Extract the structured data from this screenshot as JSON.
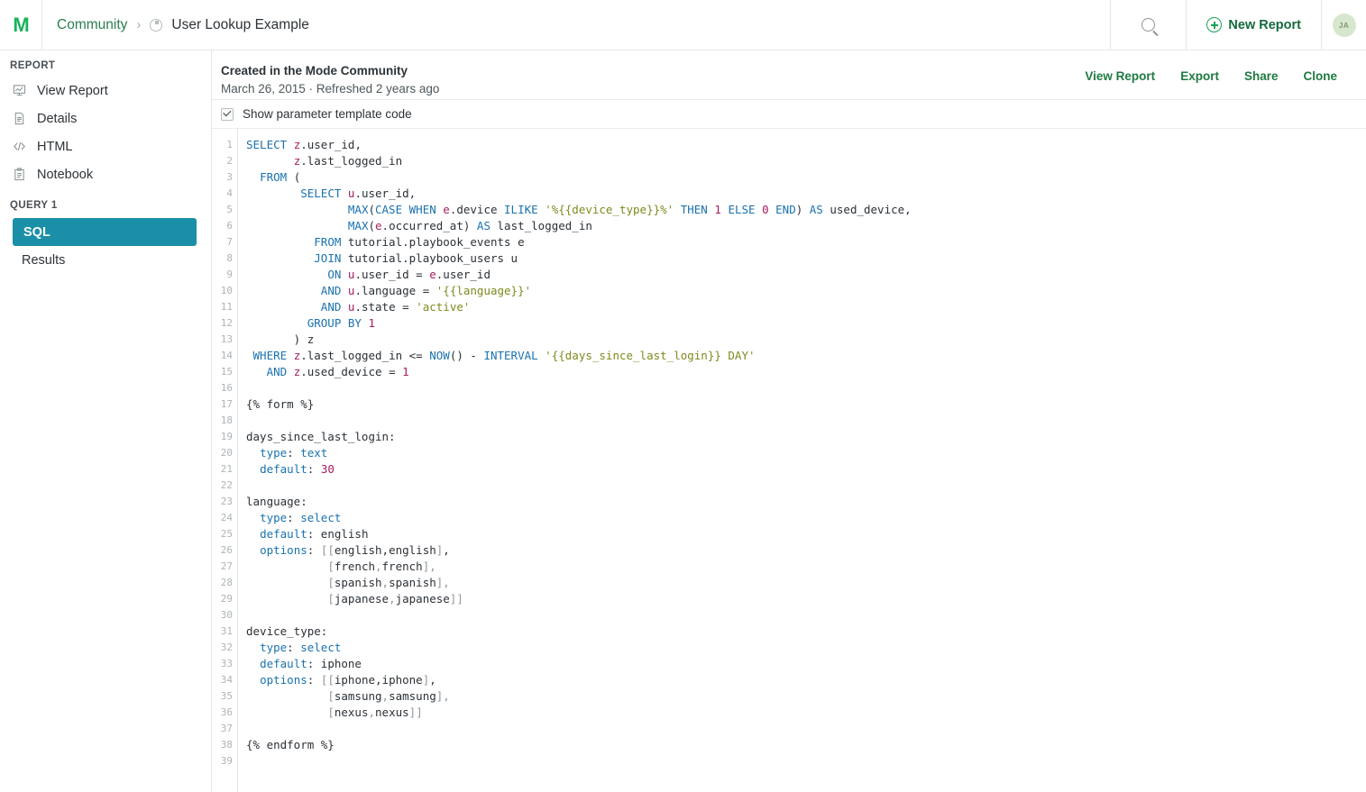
{
  "header": {
    "logo_icon": "mode-logo-icon",
    "breadcrumb": {
      "parent_label": "Community",
      "separator": "›",
      "current_icon": "clock-icon",
      "current_label": "User Lookup Example"
    },
    "search_icon": "search-icon",
    "new_report_label": "New Report",
    "new_report_icon": "plus-circle-icon",
    "avatar_initials": "JA"
  },
  "sidebar": {
    "report_section_title": "REPORT",
    "report_items": [
      {
        "label": "View Report",
        "icon": "chart-report-icon"
      },
      {
        "label": "Details",
        "icon": "document-icon"
      },
      {
        "label": "HTML",
        "icon": "code-brackets-icon"
      },
      {
        "label": "Notebook",
        "icon": "notebook-icon"
      }
    ],
    "query_section_title": "QUERY 1",
    "query_items": [
      {
        "label": "SQL",
        "selected": true
      },
      {
        "label": "Results",
        "selected": false
      }
    ],
    "selected_color": "#1b8fa8"
  },
  "sub_header": {
    "title": "Created in the Mode Community",
    "meta": "March 26, 2015 · Refreshed 2 years ago",
    "actions": [
      "View Report",
      "Export",
      "Share",
      "Clone"
    ],
    "action_color": "#1f7a42"
  },
  "parameter_bar": {
    "checkbox_checked": true,
    "checkbox_label": "Show parameter template code"
  },
  "editor": {
    "first_line_number": 1,
    "last_line_number": 39,
    "line_numbers": [
      1,
      2,
      3,
      4,
      5,
      6,
      7,
      8,
      9,
      10,
      11,
      12,
      13,
      14,
      15,
      16,
      17,
      18,
      19,
      20,
      21,
      22,
      23,
      24,
      25,
      26,
      27,
      28,
      29,
      30,
      31,
      32,
      33,
      34,
      35,
      36,
      37,
      38,
      39
    ],
    "language": "sql",
    "syntax_colors": {
      "keyword": "#1a72b0",
      "string": "#7f8a1e",
      "number": "#a71d5d",
      "alias": "#a71d5d",
      "plain": "#2b3137",
      "gutter": "#aeb4b8"
    },
    "lines": [
      "SELECT z.user_id,",
      "       z.last_logged_in",
      "  FROM (",
      "        SELECT u.user_id,",
      "               MAX(CASE WHEN e.device ILIKE '%{{device_type}}%' THEN 1 ELSE 0 END) AS used_device,",
      "               MAX(e.occurred_at) AS last_logged_in",
      "          FROM tutorial.playbook_events e",
      "          JOIN tutorial.playbook_users u",
      "            ON u.user_id = e.user_id",
      "           AND u.language = '{{language}}'",
      "           AND u.state = 'active'",
      "         GROUP BY 1",
      "       ) z",
      " WHERE z.last_logged_in <= NOW() - INTERVAL '{{days_since_last_login}} DAY'",
      "   AND z.used_device = 1",
      "",
      "{% form %}",
      "",
      "days_since_last_login:",
      "  type: text",
      "  default: 30",
      "",
      "language:",
      "  type: select",
      "  default: english",
      "  options: [[english,english],",
      "            [french,french],",
      "            [spanish,spanish],",
      "            [japanese,japanese]]",
      "",
      "device_type:",
      "  type: select",
      "  default: iphone",
      "  options: [[iphone,iphone],",
      "            [samsung,samsung],",
      "            [nexus,nexus]]",
      "",
      "{% endform %}",
      ""
    ],
    "form_parameters": [
      {
        "name": "days_since_last_login",
        "type": "text",
        "default": "30",
        "options": []
      },
      {
        "name": "language",
        "type": "select",
        "default": "english",
        "options": [
          "english",
          "french",
          "spanish",
          "japanese"
        ]
      },
      {
        "name": "device_type",
        "type": "select",
        "default": "iphone",
        "options": [
          "iphone",
          "samsung",
          "nexus"
        ]
      }
    ]
  }
}
